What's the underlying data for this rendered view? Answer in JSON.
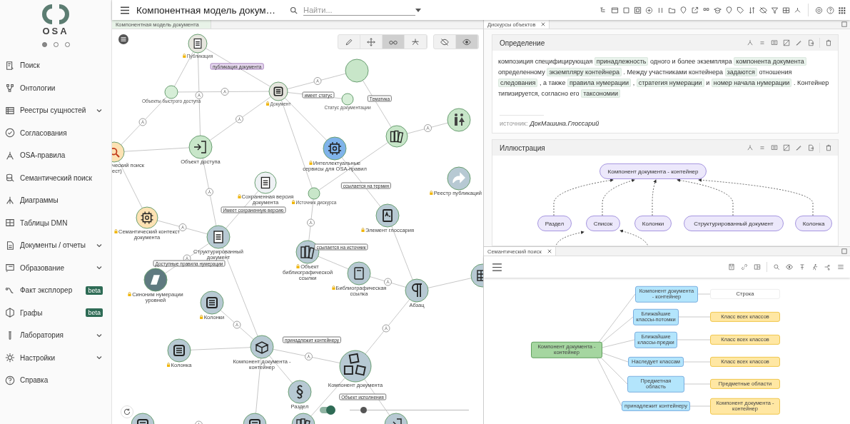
{
  "sidebar": {
    "logo": "OSA",
    "pager": [
      {
        "selected": true
      },
      {
        "selected": false
      },
      {
        "selected": false
      }
    ],
    "items": [
      {
        "label": "Поиск",
        "expandable": false
      },
      {
        "label": "Онтологии",
        "expandable": false
      },
      {
        "label": "Реестры сущностей",
        "expandable": true
      },
      {
        "label": "Согласования",
        "expandable": false
      },
      {
        "label": "OSA-правила",
        "expandable": false
      },
      {
        "label": "Семантический поиск",
        "expandable": false
      },
      {
        "label": "Диаграммы",
        "expandable": false
      },
      {
        "label": "Таблицы DMN",
        "expandable": false
      },
      {
        "label": "Документы / отчеты",
        "expandable": true
      },
      {
        "label": "Образование",
        "expandable": true
      },
      {
        "label": "Факт эксплорер",
        "expandable": false,
        "badge": "beta"
      },
      {
        "label": "Графы",
        "expandable": false,
        "badge": "beta"
      },
      {
        "label": "Лаборатория",
        "expandable": true
      },
      {
        "label": "Настройки",
        "expandable": true
      },
      {
        "label": "Справка",
        "expandable": false
      }
    ]
  },
  "header": {
    "title": "Компонентная модель докум…",
    "search": {
      "placeholder": "Найти..."
    }
  },
  "graph_panel": {
    "tab": "Компонентная модель документа",
    "tools": [
      {
        "kind": "pencil",
        "selected": false
      },
      {
        "kind": "move",
        "selected": false
      },
      {
        "kind": "glasses",
        "selected": true
      },
      {
        "kind": "network",
        "selected": false
      }
    ],
    "visibility": [
      {
        "kind": "eye-off",
        "selected": false
      },
      {
        "kind": "eye",
        "selected": true
      }
    ],
    "nodes": [
      {
        "label": "Публикация",
        "kind": "doc",
        "color": "#e6e6de",
        "locked": true
      },
      {
        "label": "Документ",
        "kind": "list",
        "color": "#e6e6de",
        "locked": true
      },
      {
        "label": "Объекты быстрого доступа",
        "kind": "plain",
        "color": "#d6eed7",
        "locked": false
      },
      {
        "label": "Объект доступа",
        "kind": "enter",
        "color": "#c8e6c9",
        "locked": false
      },
      {
        "label": "ческий поиск ест)",
        "kind": "search",
        "color": "#fde2b3",
        "locked": false
      },
      {
        "label": "Сохраненная версия документа",
        "kind": "doc",
        "color": "#eef1f4",
        "locked": true
      },
      {
        "label": "Семантический контекст документа",
        "kind": "chip",
        "color": "#fde2b3",
        "locked": true
      },
      {
        "label": "Структурированный документ",
        "kind": "doc",
        "color": "#b7c9d3",
        "locked": false
      },
      {
        "label": "Синоним нумерации уровней",
        "kind": "tag",
        "color": "#5f7a80",
        "locked": true
      },
      {
        "label": "Колонки",
        "kind": "list",
        "color": "#b7c9d3",
        "locked": true
      },
      {
        "label": "Колонка",
        "kind": "list",
        "color": "#b7c9d3",
        "locked": true
      },
      {
        "label": "Компонент документа - контейнер",
        "kind": "box",
        "color": "#b7c9d3",
        "locked": false
      },
      {
        "label": "Раздел",
        "kind": "section",
        "color": "#b7c9d3",
        "locked": false
      },
      {
        "label": "Компонент документа",
        "kind": "blocks",
        "color": "#b7c9d3",
        "locked": false
      },
      {
        "label": "Абзац",
        "kind": "paragraph",
        "color": "#b7c9d3",
        "locked": false
      },
      {
        "label": "Библиографическая ссылка",
        "kind": "book",
        "color": "#b7c9d3",
        "locked": true
      },
      {
        "label": "Объект библиографической ссылки",
        "kind": "books",
        "color": "#b7c9d3",
        "locked": true
      },
      {
        "label": "Элемент глоссария",
        "kind": "glossary",
        "color": "#b7c9d3",
        "locked": true
      },
      {
        "label": "Реестр публикаций",
        "kind": "arrow",
        "color": "#b7c9d3",
        "locked": true
      },
      {
        "label": "Статус документации",
        "kind": "plain",
        "color": "#d6eed7",
        "locked": false
      },
      {
        "kind": "books",
        "color": "#c8e6c9"
      },
      {
        "kind": "people",
        "color": "#c8e6c9"
      },
      {
        "kind": "plain",
        "color": "#c8e6c9"
      },
      {
        "label": "Интеллектуальные сервисы для OSA-правил",
        "kind": "chip",
        "color": "#7fb3ea",
        "locked": true
      },
      {
        "label": "Источник дискурса",
        "kind": "plain",
        "color": "#c8e6c9",
        "locked": true
      },
      {
        "kind": "grid",
        "color": "#b7c9d3"
      },
      {
        "kind": "list",
        "color": "#b7c9d3"
      },
      {
        "kind": "list",
        "color": "#b7c9d3"
      },
      {
        "kind": "books",
        "color": "#b7c9d3"
      },
      {
        "kind": "enter",
        "color": "#b7c9d3"
      }
    ],
    "edge_labels": [
      {
        "text": "публикация документа",
        "highlighted": true
      },
      {
        "text": "имеет статус",
        "highlighted": false
      },
      {
        "text": "Тематика",
        "highlighted": false
      },
      {
        "text": "ссылается на термин",
        "highlighted": false
      },
      {
        "text": "Имеет сохраненную версию",
        "highlighted": false
      },
      {
        "text": "Доступные правила нумерации",
        "highlighted": false
      },
      {
        "text": "ссылается на источник",
        "highlighted": false
      },
      {
        "text": "принадлежит контейнеру",
        "highlighted": false
      },
      {
        "text": "Объект исполнения",
        "highlighted": false
      }
    ],
    "toggle": {
      "on": true
    },
    "zoom_slider": {
      "level": 0.12
    }
  },
  "discourse_panel": {
    "tab": "Дискурсы объектов",
    "definition": {
      "title": "Определение",
      "segments": [
        {
          "text": "композиция специфицирующая",
          "term": false
        },
        {
          "text": "принадлежность",
          "term": true
        },
        {
          "text": "одного и более экземпляра",
          "term": false
        },
        {
          "text": "компонента документа",
          "term": true
        },
        {
          "text": "определенному",
          "term": false
        },
        {
          "text": "экземпляру контейнера",
          "term": true
        },
        {
          "text": ". Между участниками контейнера",
          "term": false
        },
        {
          "text": "задаются",
          "term": true
        },
        {
          "text": "отношения",
          "term": false
        },
        {
          "text": "следования",
          "term": true
        },
        {
          "text": ", а также",
          "term": false
        },
        {
          "text": "правила нумерации",
          "term": true
        },
        {
          "text": ",",
          "term": false
        },
        {
          "text": "стратегия нумерации",
          "term": true
        },
        {
          "text": "и",
          "term": false
        },
        {
          "text": "номер начала нумерации",
          "term": true
        },
        {
          "text": ". Контейнер типизируется, согласно его",
          "term": false
        },
        {
          "text": "таксономии",
          "term": true
        }
      ],
      "source_label": "источник:",
      "source": "ДокМашина.Глоссарий"
    },
    "illustration": {
      "title": "Иллюстрация",
      "top": "Компонент документа - контейнер",
      "children": [
        {
          "label": "Раздел"
        },
        {
          "label": "Список"
        },
        {
          "label": "Колонки"
        },
        {
          "label": "Структурированный документ"
        },
        {
          "label": "Колонка"
        }
      ]
    }
  },
  "semantic_panel": {
    "tab": "Семантический поиск",
    "root": "Компонент документа - контейнер",
    "branches": [
      {
        "relation": "Компонент документа - контейнер",
        "target": "Строка",
        "kind": "literal"
      },
      {
        "relation": "Ближайшие классы-потомки",
        "target": "Класс всех классов",
        "kind": "class"
      },
      {
        "relation": "Ближайшие классы-предки",
        "target": "Класс всех классов",
        "kind": "class"
      },
      {
        "relation": "Наследует классам",
        "target": "Класс всех классов",
        "kind": "class"
      },
      {
        "relation": "Предметная область",
        "target": "Предметные области",
        "kind": "class"
      },
      {
        "relation": "принадлежит контейнеру",
        "target": "Компонент документа - контейнер",
        "kind": "class"
      }
    ]
  }
}
